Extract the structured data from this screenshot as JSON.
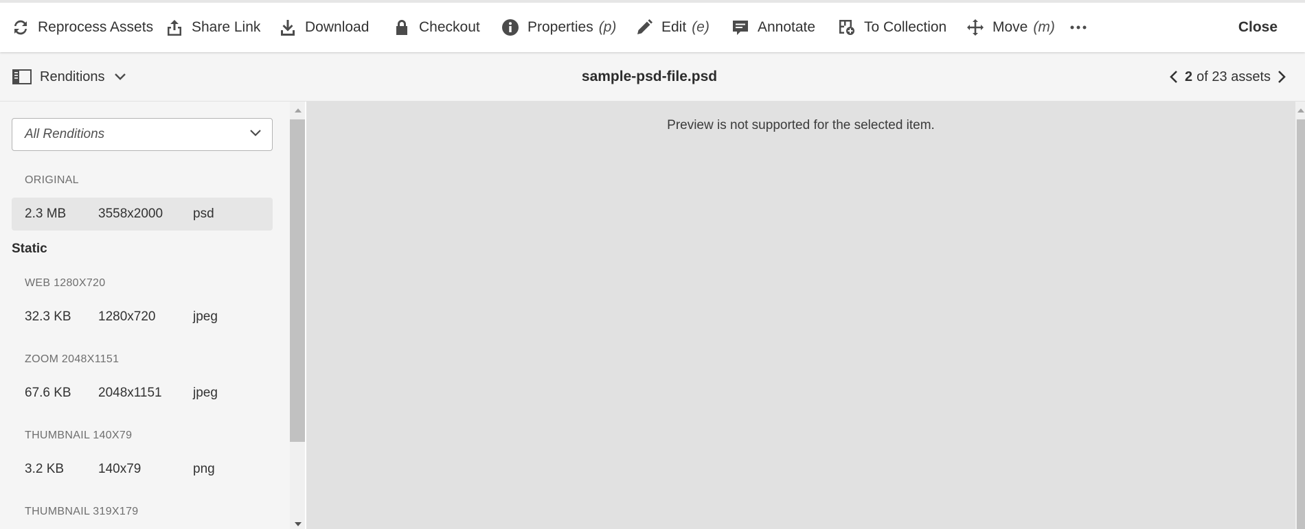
{
  "toolbar": {
    "reprocess_label": "Reprocess Assets",
    "share_label": "Share Link",
    "download_label": "Download",
    "checkout_label": "Checkout",
    "properties_label": "Properties",
    "properties_hint": "(p)",
    "edit_label": "Edit",
    "edit_hint": "(e)",
    "annotate_label": "Annotate",
    "collection_label": "To Collection",
    "move_label": "Move",
    "move_hint": "(m)",
    "more_icon": "more-icon",
    "close_label": "Close"
  },
  "subbar": {
    "renditions_label": "Renditions",
    "file_title": "sample-psd-file.psd",
    "pager_current": "2",
    "pager_rest": "of 23 assets"
  },
  "sidebar": {
    "select_value": "All Renditions",
    "original_label": "ORIGINAL",
    "original": {
      "size": "2.3 MB",
      "dim": "3558x2000",
      "fmt": "psd"
    },
    "static_heading": "Static",
    "renditions": [
      {
        "label": "WEB 1280X720",
        "size": "32.3 KB",
        "dim": "1280x720",
        "fmt": "jpeg"
      },
      {
        "label": "ZOOM 2048X1151",
        "size": "67.6 KB",
        "dim": "2048x1151",
        "fmt": "jpeg"
      },
      {
        "label": "THUMBNAIL 140X79",
        "size": "3.2 KB",
        "dim": "140x79",
        "fmt": "png"
      },
      {
        "label": "THUMBNAIL 319X179"
      }
    ]
  },
  "preview": {
    "message": "Preview is not supported for the selected item."
  },
  "colors": {
    "preview_bg": "#e1e1e1",
    "sidebar_bg": "#f5f5f5",
    "selected_row": "#e6e6e6"
  }
}
